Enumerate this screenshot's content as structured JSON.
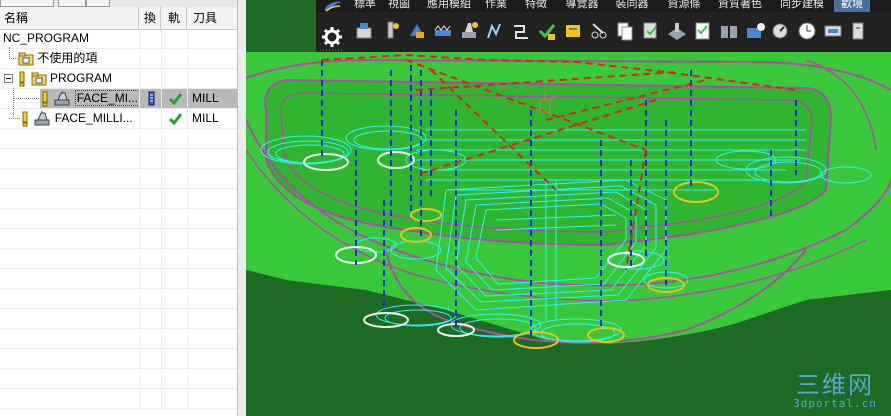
{
  "navigator": {
    "columns": [
      "名稱",
      "換",
      "軌",
      "刀具"
    ],
    "rows": [
      {
        "name": "NC_PROGRAM",
        "tool": ""
      },
      {
        "name": "不使用的項",
        "tool": ""
      },
      {
        "name": "PROGRAM",
        "tool": ""
      },
      {
        "name": "FACE_MI...",
        "tool": "MILL"
      },
      {
        "name": "FACE_MILLI...",
        "tool": "MILL"
      }
    ]
  },
  "ribbon": {
    "tabs": [
      "標準",
      "視圖",
      "應用模組",
      "作業",
      "特徵",
      "導覽器",
      "裝同器",
      "資源條",
      "資質著色",
      "同步建模",
      "歡境"
    ],
    "active_tab": "歡境"
  },
  "watermark": {
    "title": "三维网",
    "url": "3dportal.cn"
  },
  "colors": {
    "part_green": "#39c83a",
    "floor_green": "#1f6a24",
    "toolpath_cyan": "#2ff2f2",
    "edge_magenta": "#b04aa8",
    "engage_blue": "#1a2ee0",
    "rapid_red": "#e0221a"
  }
}
